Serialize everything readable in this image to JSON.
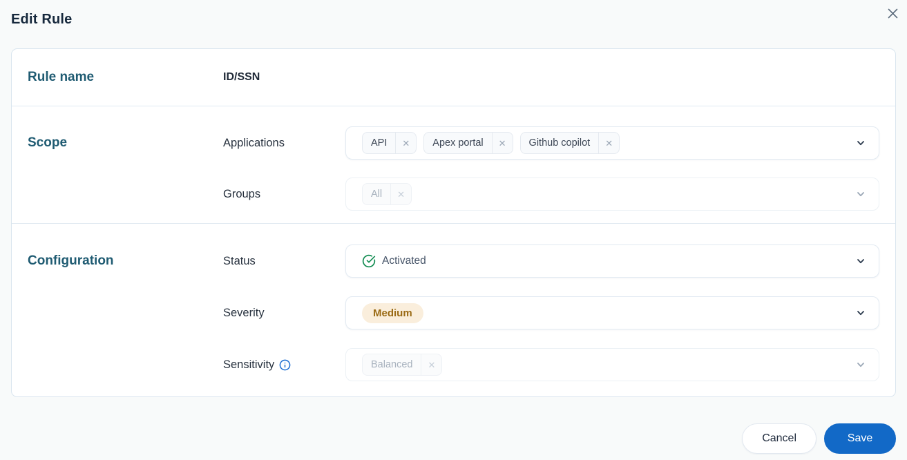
{
  "title": "Edit Rule",
  "card": {
    "rule_name": {
      "label": "Rule name",
      "value": "ID/SSN"
    },
    "scope": {
      "heading": "Scope",
      "applications": {
        "label": "Applications",
        "tags": [
          "API",
          "Apex portal",
          "Github copilot"
        ],
        "disabled": false
      },
      "groups": {
        "label": "Groups",
        "tags": [
          "All"
        ],
        "disabled": true
      }
    },
    "configuration": {
      "heading": "Configuration",
      "status": {
        "label": "Status",
        "value": "Activated"
      },
      "severity": {
        "label": "Severity",
        "value": "Medium"
      },
      "sensitivity": {
        "label": "Sensitivity",
        "tags": [
          "Balanced"
        ],
        "disabled": true
      }
    }
  },
  "footer": {
    "cancel": "Cancel",
    "save": "Save"
  },
  "colors": {
    "accent_blue": "#1269C7",
    "heading_teal": "#1F5B72",
    "title_navy": "#16283C",
    "status_green": "#0E8A4F",
    "severity_badge_bg": "#FAEEDC",
    "severity_badge_text": "#9A6A14",
    "info_blue": "#1F6FD2"
  }
}
